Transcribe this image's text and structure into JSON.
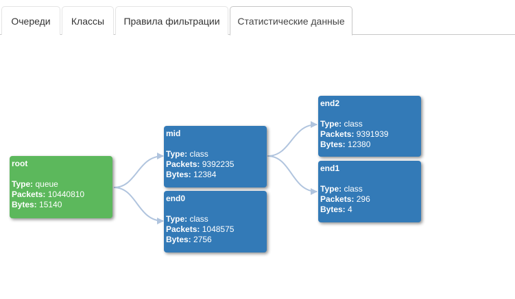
{
  "tabs": [
    {
      "label": "Очереди"
    },
    {
      "label": "Классы"
    },
    {
      "label": "Правила фильтрации"
    },
    {
      "label": "Статистические данные"
    }
  ],
  "labels": {
    "type": "Type:",
    "packets": "Packets:",
    "bytes": "Bytes:"
  },
  "colors": {
    "root": "#5cb85c",
    "node": "#337ab7",
    "link": "#b0c4de"
  },
  "nodes": {
    "root": {
      "name": "root",
      "type": "queue",
      "packets": "10440810",
      "bytes": "15140"
    },
    "mid": {
      "name": "mid",
      "type": "class",
      "packets": "9392235",
      "bytes": "12384"
    },
    "end0": {
      "name": "end0",
      "type": "class",
      "packets": "1048575",
      "bytes": "2756"
    },
    "end2": {
      "name": "end2",
      "type": "class",
      "packets": "9391939",
      "bytes": "12380"
    },
    "end1": {
      "name": "end1",
      "type": "class",
      "packets": "296",
      "bytes": "4"
    }
  }
}
